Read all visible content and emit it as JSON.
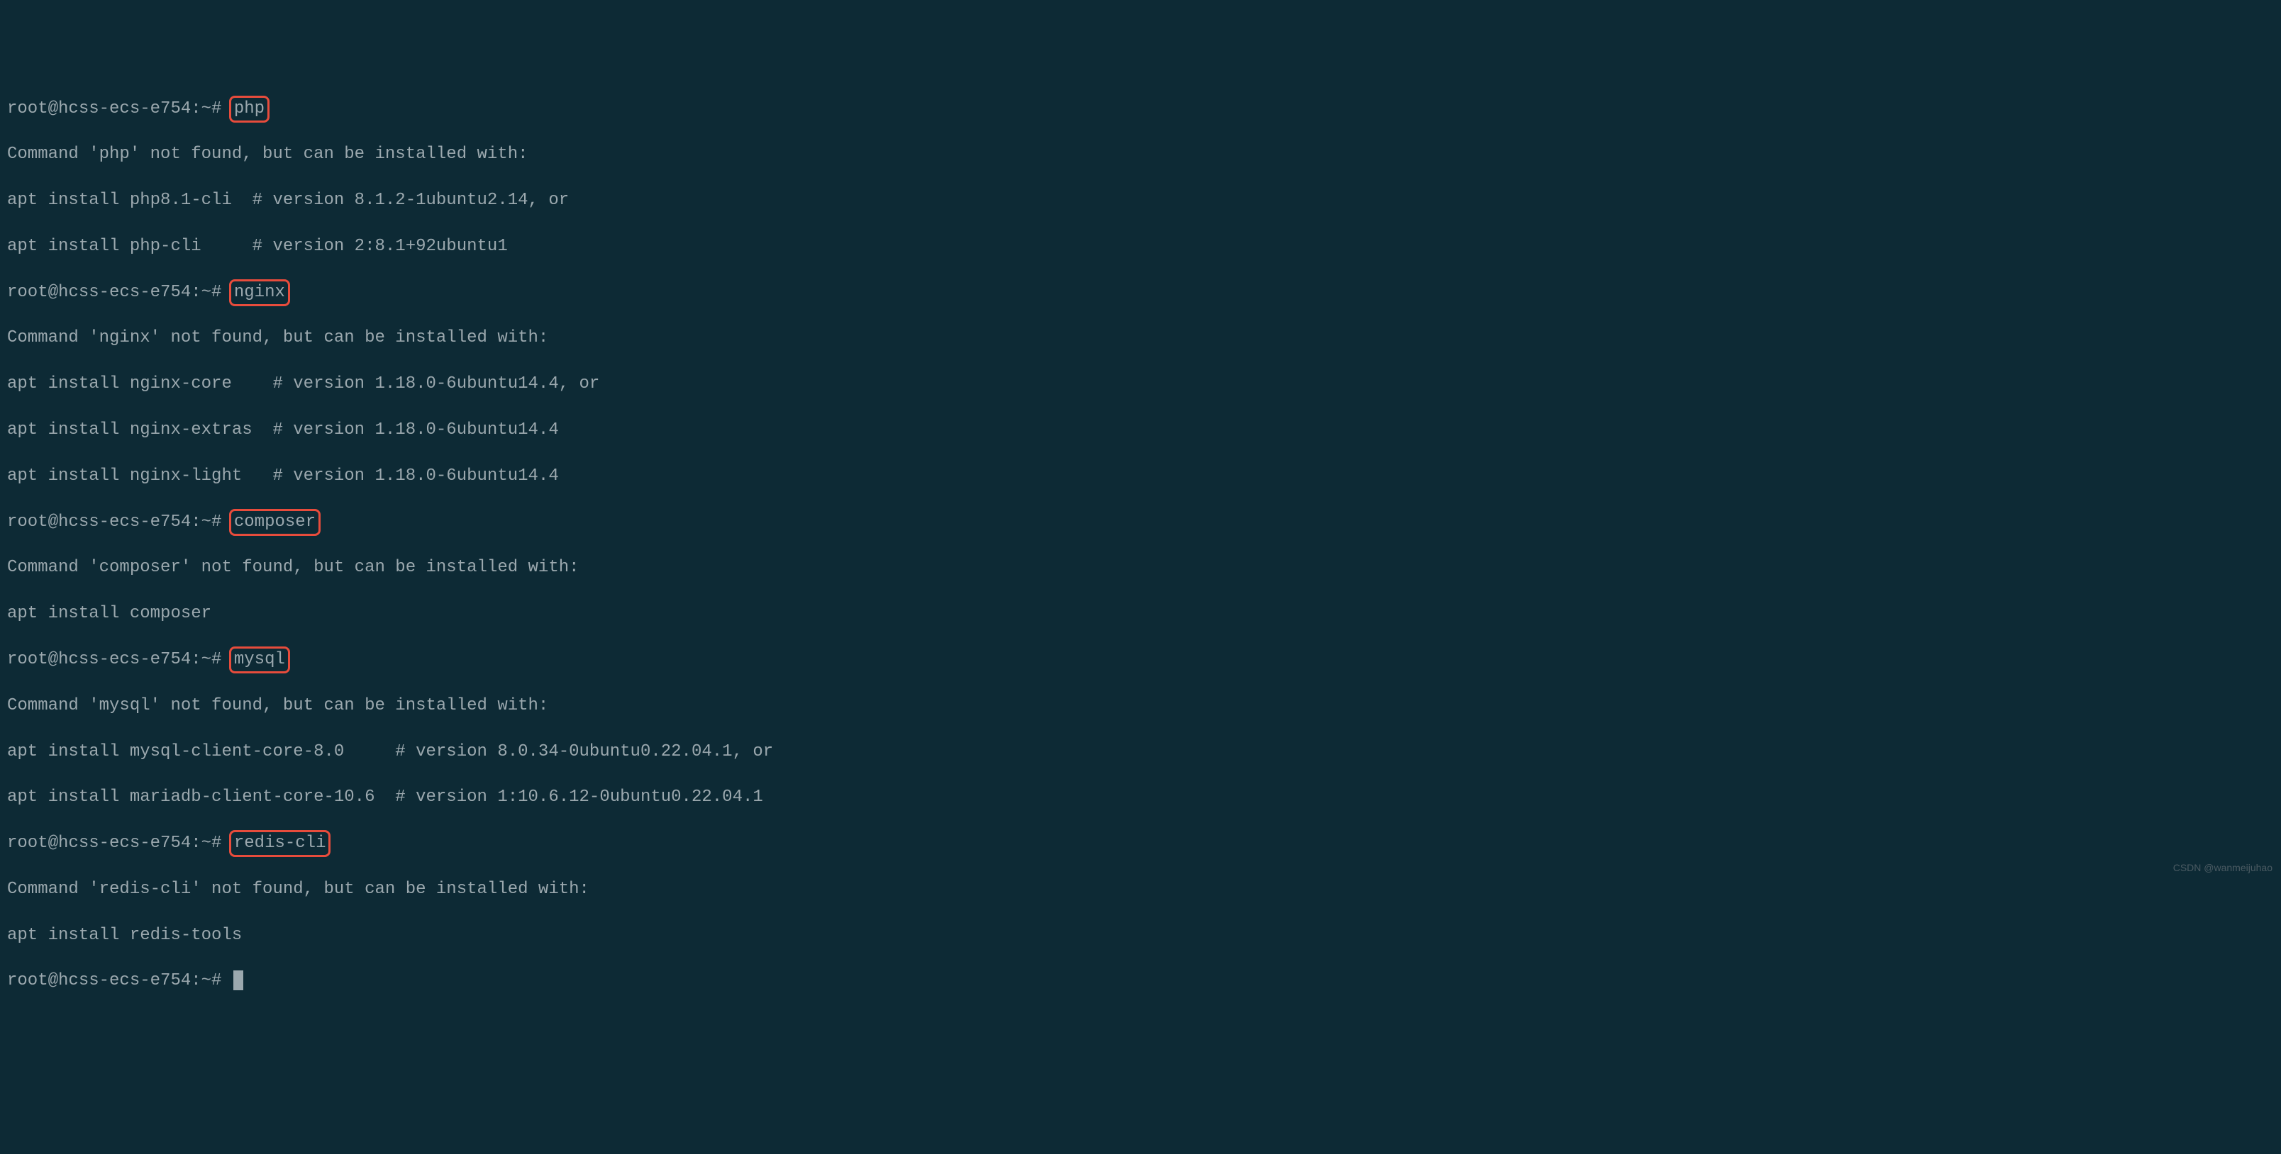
{
  "prompt": "root@hcss-ecs-e754:~# ",
  "commands": {
    "php": "php",
    "nginx": "nginx",
    "composer": "composer",
    "mysql": "mysql",
    "redis_cli": "redis-cli"
  },
  "output": {
    "php_line1": "Command 'php' not found, but can be installed with:",
    "php_line2": "apt install php8.1-cli  # version 8.1.2-1ubuntu2.14, or",
    "php_line3": "apt install php-cli     # version 2:8.1+92ubuntu1",
    "nginx_line1": "Command 'nginx' not found, but can be installed with:",
    "nginx_line2": "apt install nginx-core    # version 1.18.0-6ubuntu14.4, or",
    "nginx_line3": "apt install nginx-extras  # version 1.18.0-6ubuntu14.4",
    "nginx_line4": "apt install nginx-light   # version 1.18.0-6ubuntu14.4",
    "composer_line1": "Command 'composer' not found, but can be installed with:",
    "composer_line2": "apt install composer",
    "mysql_line1": "Command 'mysql' not found, but can be installed with:",
    "mysql_line2": "apt install mysql-client-core-8.0     # version 8.0.34-0ubuntu0.22.04.1, or",
    "mysql_line3": "apt install mariadb-client-core-10.6  # version 1:10.6.12-0ubuntu0.22.04.1",
    "redis_line1": "Command 'redis-cli' not found, but can be installed with:",
    "redis_line2": "apt install redis-tools"
  },
  "watermark": "CSDN @wanmeijuhao"
}
